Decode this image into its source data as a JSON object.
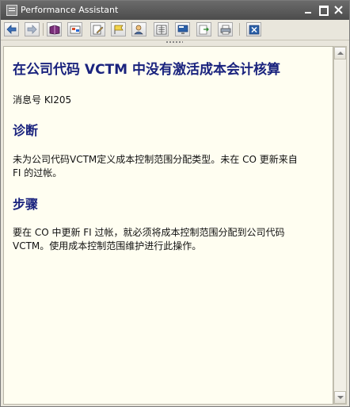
{
  "window": {
    "title": "Performance Assistant"
  },
  "toolbar": {
    "buttons": [
      {
        "name": "back-icon"
      },
      {
        "name": "forward-icon"
      },
      {
        "name": "book-icon"
      },
      {
        "name": "technical-info-icon"
      },
      {
        "name": "edit-icon"
      },
      {
        "name": "flag-icon"
      },
      {
        "name": "user-icon"
      },
      {
        "name": "document-icon"
      },
      {
        "name": "screen-icon"
      },
      {
        "name": "export-icon"
      },
      {
        "name": "print-icon"
      },
      {
        "name": "close-icon"
      }
    ]
  },
  "doc": {
    "title": "在公司代码  VCTM 中没有激活成本会计核算",
    "message_no": "消息号  KI205",
    "section1_heading": "诊断",
    "section1_line1": "未为公司代码VCTM定义成本控制范围分配类型。未在  CO 更新来自",
    "section1_line2": "FI 的过帐。",
    "section2_heading": "步骤",
    "section2_line1": "要在  CO 中更新  FI 过帐，就必须将成本控制范围分配到公司代码",
    "section2_line2": "VCTM。使用成本控制范围维护进行此操作。"
  },
  "colors": {
    "heading": "#1a237e",
    "background": "#fffef1",
    "titlebar": "#565656"
  }
}
